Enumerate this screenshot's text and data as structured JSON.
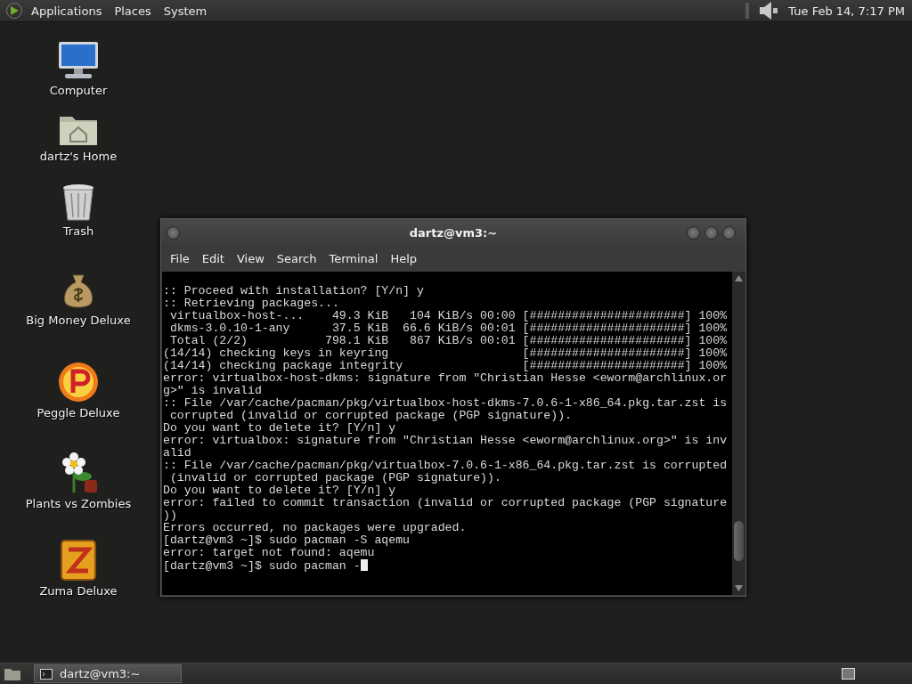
{
  "top_panel": {
    "menus": [
      "Applications",
      "Places",
      "System"
    ],
    "clock": "Tue Feb 14,  7:17 PM"
  },
  "desktop_icons": [
    {
      "label": "Computer",
      "kind": "computer"
    },
    {
      "label": "dartz's Home",
      "kind": "home"
    },
    {
      "label": "Trash",
      "kind": "trash"
    },
    {
      "label": "Big Money Deluxe",
      "kind": "money"
    },
    {
      "label": "Peggle Deluxe",
      "kind": "peggle"
    },
    {
      "label": "Plants vs Zombies",
      "kind": "plants"
    },
    {
      "label": "Zuma Deluxe",
      "kind": "zuma"
    }
  ],
  "terminal": {
    "title": "dartz@vm3:~",
    "menus": [
      "File",
      "Edit",
      "View",
      "Search",
      "Terminal",
      "Help"
    ],
    "lines": [
      ":: Proceed with installation? [Y/n] y",
      ":: Retrieving packages...",
      " virtualbox-host-...    49.3 KiB   104 KiB/s 00:00 [######################] 100%",
      " dkms-3.0.10-1-any      37.5 KiB  66.6 KiB/s 00:01 [######################] 100%",
      " Total (2/2)           798.1 KiB   867 KiB/s 00:01 [######################] 100%",
      "(14/14) checking keys in keyring                   [######################] 100%",
      "(14/14) checking package integrity                 [######################] 100%",
      "error: virtualbox-host-dkms: signature from \"Christian Hesse <eworm@archlinux.or",
      "g>\" is invalid",
      ":: File /var/cache/pacman/pkg/virtualbox-host-dkms-7.0.6-1-x86_64.pkg.tar.zst is",
      " corrupted (invalid or corrupted package (PGP signature)).",
      "Do you want to delete it? [Y/n] y",
      "error: virtualbox: signature from \"Christian Hesse <eworm@archlinux.org>\" is inv",
      "alid",
      ":: File /var/cache/pacman/pkg/virtualbox-7.0.6-1-x86_64.pkg.tar.zst is corrupted",
      " (invalid or corrupted package (PGP signature)).",
      "Do you want to delete it? [Y/n] y",
      "error: failed to commit transaction (invalid or corrupted package (PGP signature",
      "))",
      "Errors occurred, no packages were upgraded.",
      "[dartz@vm3 ~]$ sudo pacman -S aqemu",
      "error: target not found: aqemu",
      "[dartz@vm3 ~]$ sudo pacman -"
    ]
  },
  "taskbar": {
    "tasks": [
      {
        "label": "dartz@vm3:~",
        "selected": true
      }
    ]
  }
}
